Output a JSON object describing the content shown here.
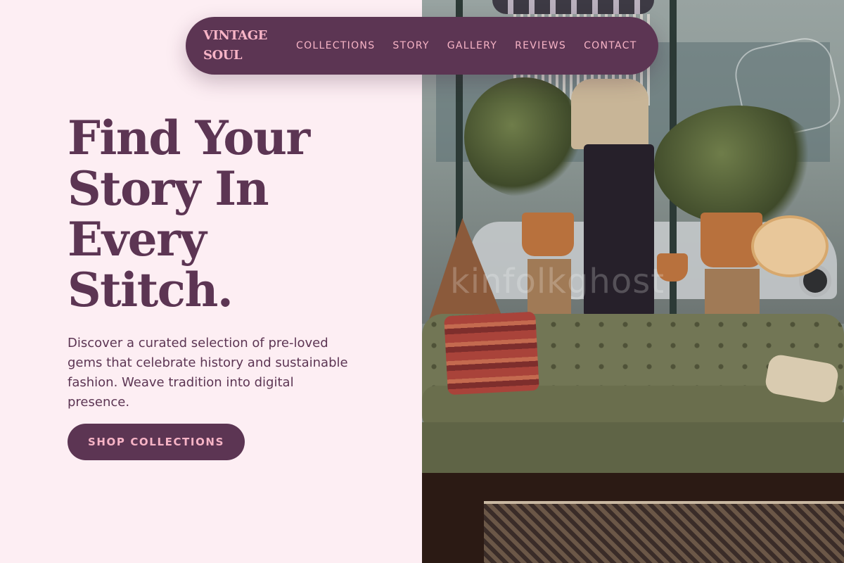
{
  "brand": {
    "logo_text": "VINTAGE SOUL",
    "colors": {
      "primary": "#5c3553",
      "accent": "#f7b4c6",
      "background": "#fdeef3"
    }
  },
  "nav": {
    "links": [
      {
        "label": "COLLECTIONS"
      },
      {
        "label": "STORY"
      },
      {
        "label": "GALLERY"
      },
      {
        "label": "REVIEWS"
      },
      {
        "label": "CONTACT"
      }
    ]
  },
  "hero": {
    "headline": "Find Your Story In Every Stitch.",
    "description": "Discover a curated selection of pre-loved gems that celebrate history and sustainable fashion. Weave tradition into digital presence.",
    "cta_label": "SHOP COLLECTIONS",
    "image_watermark": "kinfolkghost"
  }
}
